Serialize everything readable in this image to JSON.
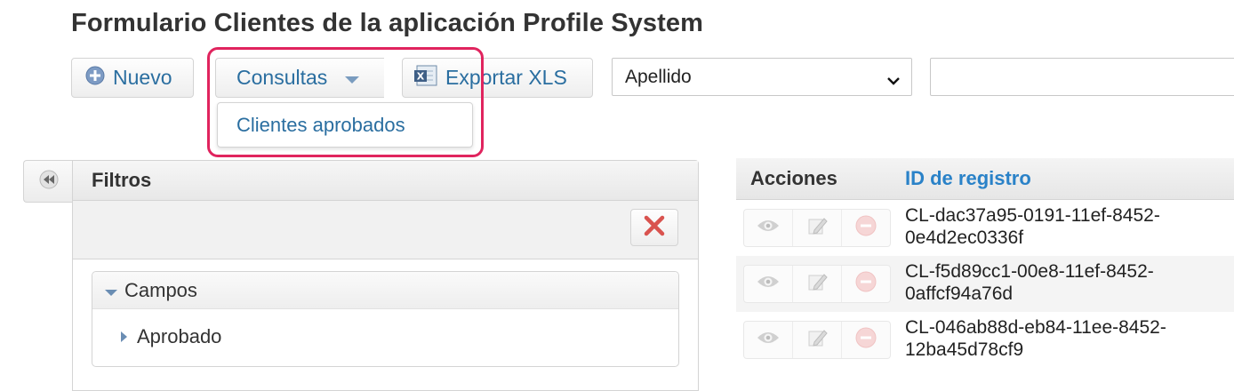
{
  "page": {
    "title": "Formulario Clientes de la aplicación Profile System"
  },
  "toolbar": {
    "nuevo_label": "Nuevo",
    "consultas_label": "Consultas",
    "export_label": "Exportar XLS",
    "search_field": {
      "selected": "Apellido",
      "options": [
        "Apellido"
      ]
    },
    "search_value": ""
  },
  "dropdown": {
    "items": [
      {
        "label": "Clientes aprobados"
      }
    ]
  },
  "filters": {
    "title": "Filtros",
    "group_label": "Campos",
    "fields": [
      {
        "label": "Aprobado"
      }
    ]
  },
  "grid": {
    "columns": {
      "actions": "Acciones",
      "id": "ID de registro"
    },
    "rows": [
      {
        "id_line1": "CL-dac37a95-0191-11ef-8452-",
        "id_line2": "0e4d2ec0336f"
      },
      {
        "id_line1": "CL-f5d89cc1-00e8-11ef-8452-",
        "id_line2": "0affcf94a76d"
      },
      {
        "id_line1": "CL-046ab88d-eb84-11ee-8452-",
        "id_line2": "12ba45d78cf9"
      }
    ]
  },
  "colors": {
    "accent": "#2a6ea0",
    "link": "#2a82c8",
    "highlight": "#e0245e"
  }
}
